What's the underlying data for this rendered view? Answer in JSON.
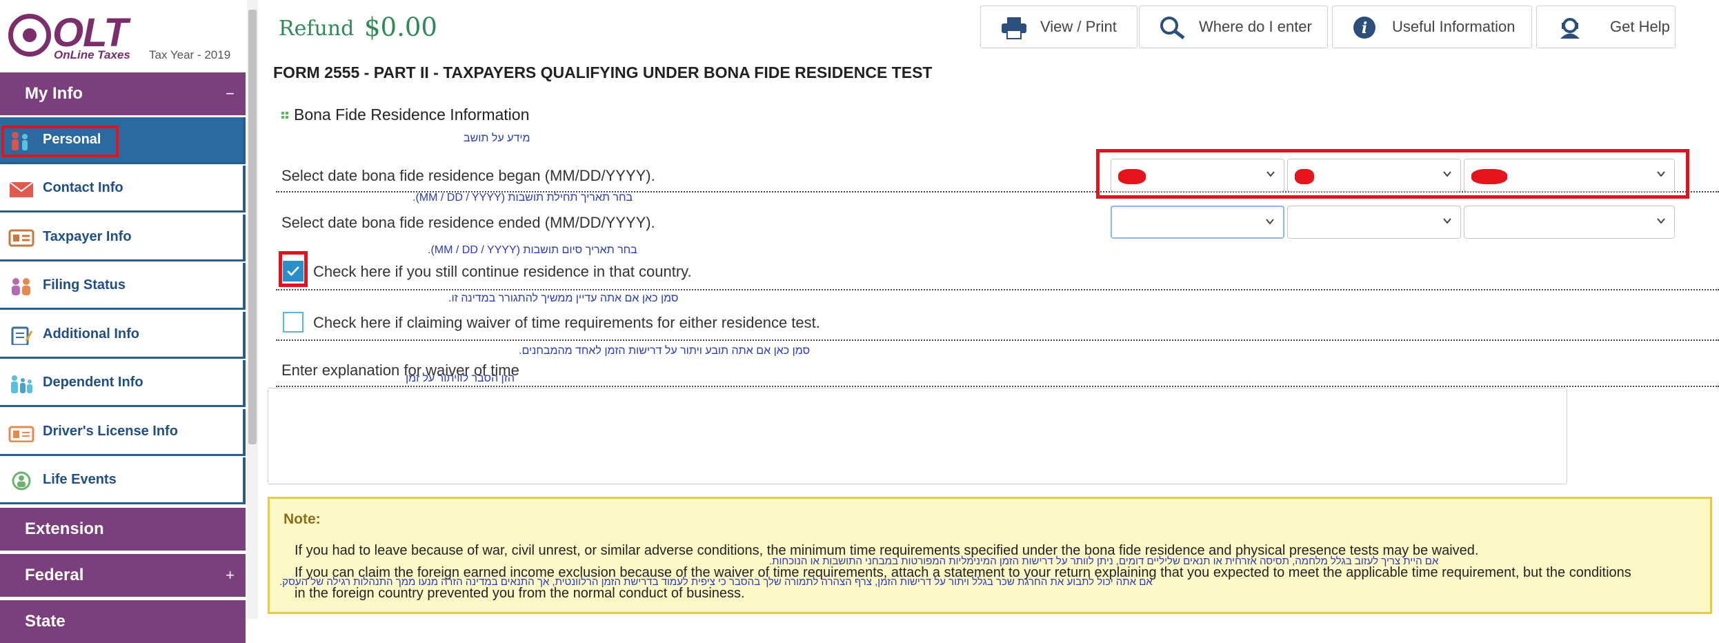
{
  "brand": {
    "name": "OLT",
    "tagline": "OnLine Taxes",
    "tax_year": "Tax Year - 2019"
  },
  "sidebar": {
    "my_info": {
      "label": "My Info",
      "toggle": "−"
    },
    "items": [
      {
        "label": "Personal",
        "icon": "family-icon"
      },
      {
        "label": "Contact Info",
        "icon": "envelope-icon"
      },
      {
        "label": "Taxpayer Info",
        "icon": "id-card-icon"
      },
      {
        "label": "Filing Status",
        "icon": "couple-icon"
      },
      {
        "label": "Additional Info",
        "icon": "clipboard-icon"
      },
      {
        "label": "Dependent Info",
        "icon": "dependents-icon"
      },
      {
        "label": "Driver's License Info",
        "icon": "license-icon"
      },
      {
        "label": "Life Events",
        "icon": "life-events-icon"
      }
    ],
    "extension": {
      "label": "Extension"
    },
    "federal": {
      "label": "Federal",
      "toggle": "+"
    },
    "state": {
      "label": "State"
    }
  },
  "header": {
    "refund_label": "Refund",
    "refund_value": "$0.00",
    "buttons": [
      {
        "label": "View / Print",
        "icon": "printer-icon"
      },
      {
        "label": "Where do I enter",
        "icon": "search-icon"
      },
      {
        "label": "Useful Information",
        "icon": "info-icon"
      },
      {
        "label": "Get Help",
        "icon": "help-agent-icon"
      }
    ]
  },
  "form": {
    "title": "FORM 2555 - PART II - TAXPAYERS QUALIFYING UNDER BONA FIDE RESIDENCE TEST",
    "section": "Bona Fide Residence Information",
    "section_heb": "מידע על תושב",
    "began": {
      "label": "Select date bona fide residence began (MM/DD/YYYY).",
      "heb": "בחר תאריך תחילת תושבות (MM / DD / YYYY)."
    },
    "ended": {
      "label": "Select date bona fide residence ended (MM/DD/YYYY).",
      "heb": "בחר תאריך סיום תושבות (MM / DD / YYYY)."
    },
    "continue": {
      "label": "Check here if you still continue residence in that country.",
      "heb": "סמן כאן אם אתה עדיין ממשיך להתגורר במדינה זו.",
      "checked": true
    },
    "waiver": {
      "label": "Check here if claiming waiver of time requirements for either residence test.",
      "heb": "סמן כאן אם אתה תובע ויתור על דרישות הזמן לאחד מהמבחנים.",
      "checked": false
    },
    "explanation": {
      "label": "Enter explanation for waiver of time",
      "heb": "הזן הסבר לוויתור על זמן",
      "value": ""
    }
  },
  "note": {
    "title": "Note:",
    "p1": "If you had to leave because of war, civil unrest, or similar adverse conditions, the minimum time requirements specified under the bona fide residence and physical presence tests may be waived.",
    "p1_heb": "אם היית צריך לעזוב בגלל מלחמה, תסיסה אזרחית או תנאים שליליים דומים, ניתן לוותר על דרישות הזמן המינימליות המפורטות במבחני התושבות או הנוכחות.",
    "p2a": "If you can claim the foreign earned income exclusion because of the waiver of time requirements, attach a statement to your return explaining that you expected to meet the applicable time requirement, but the conditions",
    "p2b": "in the foreign country prevented you from the normal conduct of business.",
    "p2_heb": "אם אתה יכול לתבוע את החרגת שכר בגלל ויתור על דרישות הזמן, צרף הצהרה לתמורה שלך בהסבר כי ציפית לעמוד בדרישת הזמן הרלוונטית, אך התנאים במדינה הזרה מנעו ממך התנהלות רגילה של העסק."
  },
  "colors": {
    "sidebar_purple": "#7b3f7e",
    "nav_blue": "#2a6aa0",
    "refund_green": "#2e8b57",
    "highlight_red": "#e0141e",
    "note_bg": "#fdf9c6"
  }
}
